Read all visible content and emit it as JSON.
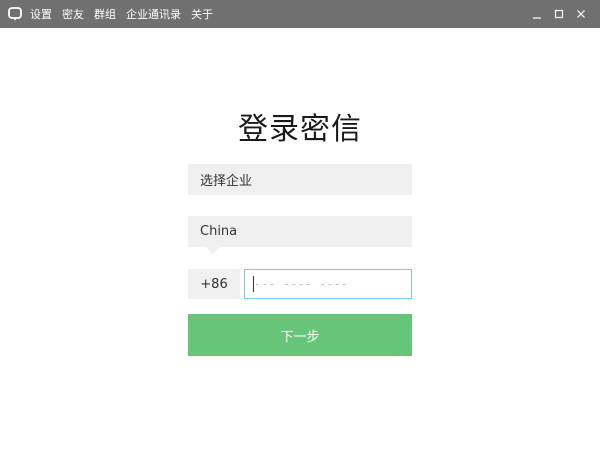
{
  "titlebar": {
    "background": "#707070",
    "logo_icon": "chat-bubble-logo-icon",
    "menu": [
      {
        "label": "设置"
      },
      {
        "label": "密友"
      },
      {
        "label": "群组"
      },
      {
        "label": "企业通讯录"
      },
      {
        "label": "关于"
      }
    ],
    "controls": [
      "minimize-icon",
      "maximize-icon",
      "close-icon"
    ]
  },
  "login": {
    "title": "登录密信",
    "company_field": "选择企业",
    "country_field": "China",
    "country_code": "+86",
    "phone_placeholder": "--- ---- ----",
    "phone_value": "",
    "phone_border_color": "#7ec4ec",
    "next_button": "下一步",
    "next_button_color": "#66c579"
  }
}
